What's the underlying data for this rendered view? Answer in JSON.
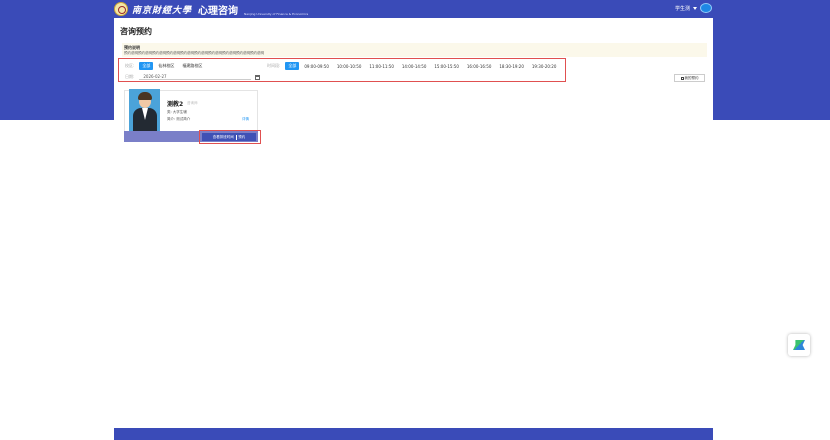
{
  "header": {
    "logo_text": "南京財經大學",
    "logo_subtitle": "Nanjing University of Finance & Economics",
    "app_title": "心理咨询",
    "user_name": "学生测"
  },
  "page": {
    "title": "咨询预约",
    "notice_label": "预约说明",
    "notice_text": "预约说明预约说明预约说明预约说明预约说明预约说明预约说明预约说明预约说明预约说明"
  },
  "filters": {
    "campus_label": "校区:",
    "campus_options": [
      "全部",
      "仙林校区",
      "福建路校区"
    ],
    "time_label": "时间段:",
    "time_options": [
      "全部",
      "09:00-09:50",
      "10:00-10:50",
      "11:00-11:50",
      "14:00-14:50",
      "15:00-15:50",
      "16:00-16:50",
      "18:30-19:20",
      "19:30-20:20"
    ],
    "date_label": "日期:",
    "date_value": "2026-02-27"
  },
  "my_appointments_label": "我的预约",
  "counselor": {
    "name": "测教2",
    "title": "咨询师",
    "field": "类: 大学生辅",
    "bio": "简介: 测试简介",
    "detail_link": "详情",
    "view_schedule_label": "查看排班时间",
    "book_label": "预约"
  },
  "colors": {
    "brand": "#3a4bb8",
    "accent": "#2196f3",
    "highlight": "#e05050"
  }
}
